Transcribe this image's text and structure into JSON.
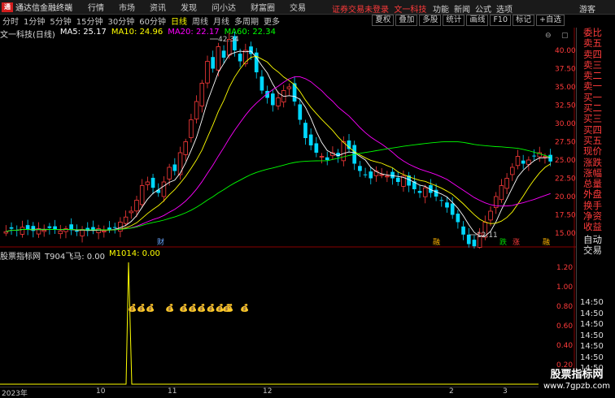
{
  "app": {
    "name": "通达信金融终端"
  },
  "menu": [
    "行情",
    "市场",
    "资讯",
    "发现",
    "问小达",
    "财富圈",
    "交易"
  ],
  "notice": "证券交易未登录",
  "stock_header": "文一科技",
  "right_menu": [
    "功能",
    "新闻",
    "公式",
    "选项",
    "游客"
  ],
  "period_tabs": [
    "分时",
    "1分钟",
    "5分钟",
    "15分钟",
    "30分钟",
    "60分钟",
    "日线",
    "周线",
    "月线",
    "多周期",
    "更多"
  ],
  "active_tab": "日线",
  "toolbar": [
    "叠加",
    "多股",
    "统计",
    "画线",
    "F10",
    "标记",
    "+自选"
  ],
  "toolbar_first": "夏权",
  "main_legend": {
    "title": "文一科技(日线)",
    "ma5": "MA5: 25.17",
    "ma10": "MA10: 24.96",
    "ma20": "MA20: 22.17",
    "ma60": "MA60: 22.34"
  },
  "colors": {
    "ma5": "#ffffff",
    "ma10": "#ffff00",
    "ma20": "#ff00ff",
    "ma60": "#00ff00",
    "up": "#ff3b3b",
    "down": "#00d8ff",
    "bg": "#000000"
  },
  "y_axis_main": [
    "40.00",
    "37.50",
    "35.00",
    "32.50",
    "30.00",
    "27.50",
    "25.00",
    "22.50",
    "20.00",
    "17.50",
    "15.00"
  ],
  "annotations": {
    "high": "42.34",
    "low": "12.11"
  },
  "event_marks": [
    "财",
    "融",
    "跌",
    "涨",
    "融"
  ],
  "right_panel": [
    "委比",
    "卖五",
    "卖四",
    "卖三",
    "卖二",
    "卖一",
    "买一",
    "买二",
    "买三",
    "买四",
    "买五",
    "现价",
    "涨跌",
    "涨幅",
    "总量",
    "外盘",
    "换手",
    "净资",
    "收益",
    "自动",
    "交易"
  ],
  "indicator_legend": {
    "name": "股票指标网",
    "t904": "T904飞马: 0.00",
    "m1014": "M1014: 0.00"
  },
  "y_axis_ind": [
    "1.20",
    "1.00",
    "0.80",
    "0.60",
    "0.40",
    "0.20"
  ],
  "right_times": [
    "14:50",
    "14:50",
    "14:50",
    "14:50",
    "14:50",
    "14:50",
    "14:50",
    "14:50",
    "14:50"
  ],
  "x_axis": [
    "2023年",
    "10",
    "11",
    "12",
    "2",
    "3"
  ],
  "watermark": {
    "line1": "股票指标网",
    "line2": "www.7gpzb.com"
  },
  "chart_data": {
    "type": "candlestick",
    "ylim": [
      14,
      42
    ],
    "close": [
      15.2,
      15.6,
      15.4,
      15.8,
      15.5,
      15.3,
      15.6,
      15.4,
      15.7,
      15.5,
      15.3,
      15.6,
      15.4,
      15.2,
      15.5,
      15.3,
      15.4,
      15.6,
      15.3,
      15.5,
      15.8,
      16.5,
      17.2,
      18.0,
      19.5,
      21.5,
      22.0,
      21.2,
      20.5,
      22.0,
      24.0,
      23.5,
      26.0,
      27.5,
      30.5,
      33.0,
      35.5,
      38.5,
      37.5,
      40.5,
      39.0,
      41.5,
      40.0,
      38.5,
      40.0,
      39.5,
      37.0,
      34.5,
      33.5,
      32.5,
      33.5,
      34.5,
      35.0,
      33.0,
      30.5,
      28.0,
      27.0,
      26.0,
      25.5,
      25.0,
      26.0,
      25.5,
      27.5,
      26.5,
      24.5,
      23.5,
      23.0,
      22.5,
      23.5,
      23.0,
      22.8,
      22.5,
      22.0,
      22.8,
      21.5,
      21.0,
      20.5,
      21.2,
      20.5,
      20.0,
      19.5,
      18.5,
      17.5,
      16.5,
      14.8,
      13.5,
      13.2,
      15.0,
      16.5,
      18.0,
      20.0,
      21.5,
      22.5,
      24.0,
      25.5,
      24.5,
      25.0,
      25.5,
      26.0,
      25.5,
      24.8
    ],
    "spikes": {
      "T904": [
        [
          18,
          1.27
        ]
      ]
    }
  }
}
